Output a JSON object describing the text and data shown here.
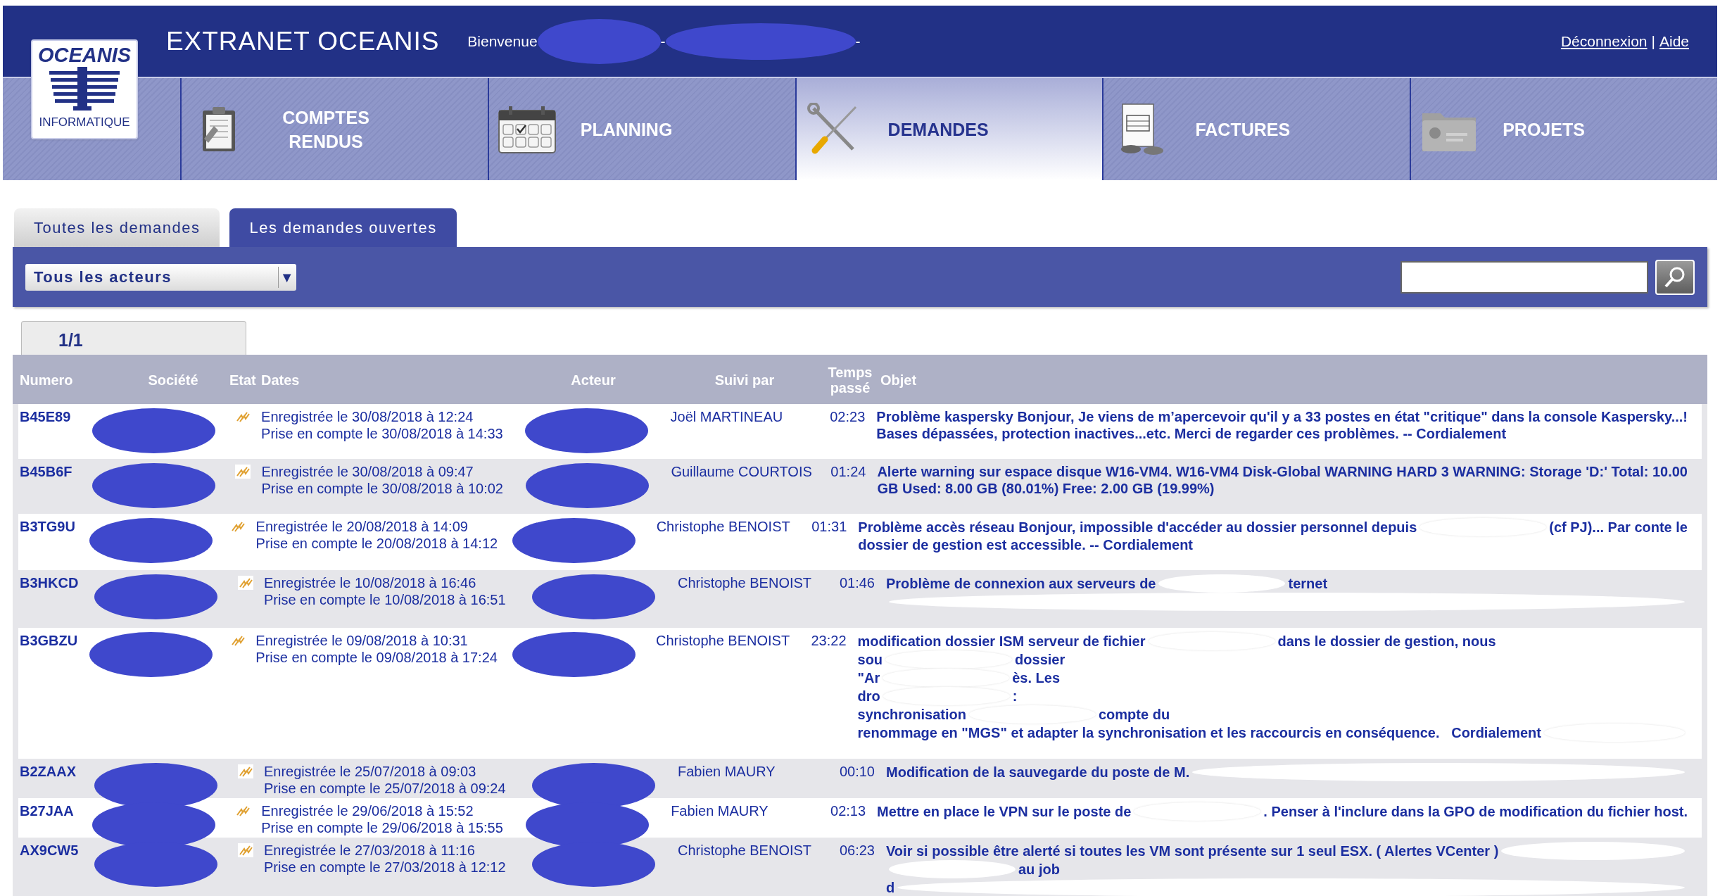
{
  "logo": {
    "name": "OCEANIS",
    "subtitle": "INFORMATIQUE"
  },
  "header": {
    "title": "EXTRANET OCEANIS",
    "welcome": "Bienvenue",
    "separators": [
      "-",
      "-"
    ],
    "links": [
      "Déconnexion",
      "Aide"
    ],
    "link_separator": "|"
  },
  "nav": [
    {
      "label": "COMPTES RENDUS",
      "selected": false
    },
    {
      "label": "PLANNING",
      "selected": false
    },
    {
      "label": "DEMANDES",
      "selected": true
    },
    {
      "label": "FACTURES",
      "selected": false
    },
    {
      "label": "PROJETS",
      "selected": false
    }
  ],
  "tabs": [
    {
      "label": "Toutes les demandes",
      "selected": false
    },
    {
      "label": "Les demandes ouvertes",
      "selected": true
    }
  ],
  "filter": {
    "value": "Tous les acteurs",
    "arrow": "▼"
  },
  "pagination": "1/1",
  "table": {
    "columns": [
      "Numero",
      "Société",
      "Etat",
      "Dates",
      "Acteur",
      "Suivi par",
      "Temps passé",
      "Objet"
    ],
    "rows": [
      {
        "numero": "B45E89",
        "registered": "Enregistrée le 30/08/2018 à 12:24",
        "taken": "Prise en compte le 30/08/2018 à 14:33",
        "suivi": "Joël MARTINEAU",
        "temps": "02:23",
        "objet": [
          [
            {
              "kind": "text",
              "text": "Problème kaspersky Bonjour, Je viens de m’apercevoir qu'il y a 33 postes en état \"critique\" dans la console Kaspersky...!"
            }
          ],
          [
            {
              "kind": "text",
              "text": "Bases dépassées, protection inactives...etc. Merci de regarder ces problèmes. -- Cordialement"
            }
          ]
        ]
      },
      {
        "numero": "B45B6F",
        "registered": "Enregistrée le 30/08/2018 à 09:47",
        "taken": "Prise en compte le 30/08/2018 à 10:02",
        "suivi": "Guillaume COURTOIS",
        "temps": "01:24",
        "objet": [
          [
            {
              "kind": "text",
              "text": "Alerte warning sur espace disque W16-VM4. W16-VM4 Disk-Global WARNING HARD 3 WARNING: Storage 'D:' Total: 10.00"
            }
          ],
          [
            {
              "kind": "text",
              "text": "GB Used: 8.00 GB (80.01%) Free: 2.00 GB (19.99%)"
            }
          ]
        ]
      },
      {
        "numero": "B3TG9U",
        "registered": "Enregistrée le 20/08/2018 à 14:09",
        "taken": "Prise en compte le 20/08/2018 à 14:12",
        "suivi": "Christophe BENOIST",
        "temps": "01:31",
        "objet": [
          [
            {
              "kind": "text",
              "text": "Problème accès réseau Bonjour, impossible d'accéder au dossier personnel depuis"
            },
            {
              "kind": "redacted"
            },
            {
              "kind": "text",
              "text": "(cf PJ)... Par conte le"
            }
          ],
          [
            {
              "kind": "text",
              "text": "dossier de gestion est accessible. -- Cordialement"
            }
          ]
        ]
      },
      {
        "numero": "B3HKCD",
        "registered": "Enregistrée le 10/08/2018 à 16:46",
        "taken": "Prise en compte le 10/08/2018 à 16:51",
        "suivi": "Christophe BENOIST",
        "temps": "01:46",
        "objet": [
          [
            {
              "kind": "text",
              "text": "Problème de connexion aux serveurs de"
            },
            {
              "kind": "redacted"
            },
            {
              "kind": "text",
              "text": "ternet"
            }
          ],
          [
            {
              "kind": "redacted"
            }
          ]
        ]
      },
      {
        "numero": "B3GBZU",
        "registered": "Enregistrée le 09/08/2018 à 10:31",
        "taken": "Prise en compte le 09/08/2018 à 17:24",
        "suivi": "Christophe BENOIST",
        "temps": "23:22",
        "objet": [
          [
            {
              "kind": "text",
              "text": "modification dossier ISM serveur de fichier"
            },
            {
              "kind": "redacted"
            },
            {
              "kind": "text",
              "text": "dans le dossier de gestion, nous"
            }
          ],
          [
            {
              "kind": "text",
              "text": "sou"
            },
            {
              "kind": "redacted"
            },
            {
              "kind": "text",
              "text": "dossier"
            }
          ],
          [
            {
              "kind": "text",
              "text": "\"Ar"
            },
            {
              "kind": "redacted"
            },
            {
              "kind": "text",
              "text": "ès. Les"
            }
          ],
          [
            {
              "kind": "text",
              "text": "dro"
            },
            {
              "kind": "redacted"
            },
            {
              "kind": "text",
              "text": ":"
            }
          ],
          [
            {
              "kind": "text",
              "text": "synchronisation"
            },
            {
              "kind": "redacted"
            },
            {
              "kind": "text",
              "text": "compte du"
            }
          ],
          [
            {
              "kind": "text",
              "text": "renommage en \"MGS\" et adapter la synchronisation et les raccourcis en conséquence.   Cordialement"
            },
            {
              "kind": "redacted"
            }
          ]
        ]
      },
      {
        "numero": "B2ZAAX",
        "registered": "Enregistrée le 25/07/2018 à 09:03",
        "taken": "Prise en compte le 25/07/2018 à 09:24",
        "suivi": "Fabien MAURY",
        "temps": "00:10",
        "objet": [
          [
            {
              "kind": "text",
              "text": "Modification de la sauvegarde du poste de M."
            },
            {
              "kind": "redacted"
            }
          ]
        ]
      },
      {
        "numero": "B27JAA",
        "registered": "Enregistrée le 29/06/2018 à 15:52",
        "taken": "Prise en compte le 29/06/2018 à 15:55",
        "suivi": "Fabien MAURY",
        "temps": "02:13",
        "objet": [
          [
            {
              "kind": "text",
              "text": "Mettre en place le VPN sur le poste de"
            },
            {
              "kind": "redacted"
            },
            {
              "kind": "text",
              "text": ". Penser à l'inclure dans la GPO de modification du fichier host."
            }
          ]
        ]
      },
      {
        "numero": "AX9CW5",
        "registered": "Enregistrée le 27/03/2018 à 11:16",
        "taken": "Prise en compte le 27/03/2018 à 12:12",
        "suivi": "Christophe BENOIST",
        "temps": "06:23",
        "objet": [
          [
            {
              "kind": "text",
              "text": "Voir si possible être alerté si toutes les VM sont présente sur 1 seul ESX. ( Alertes VCenter )"
            },
            {
              "kind": "redacted"
            }
          ],
          [
            {
              "kind": "redacted"
            },
            {
              "kind": "text",
              "text": "au job"
            }
          ],
          [
            {
              "kind": "text",
              "text": "d"
            },
            {
              "kind": "redacted"
            }
          ]
        ]
      }
    ]
  }
}
